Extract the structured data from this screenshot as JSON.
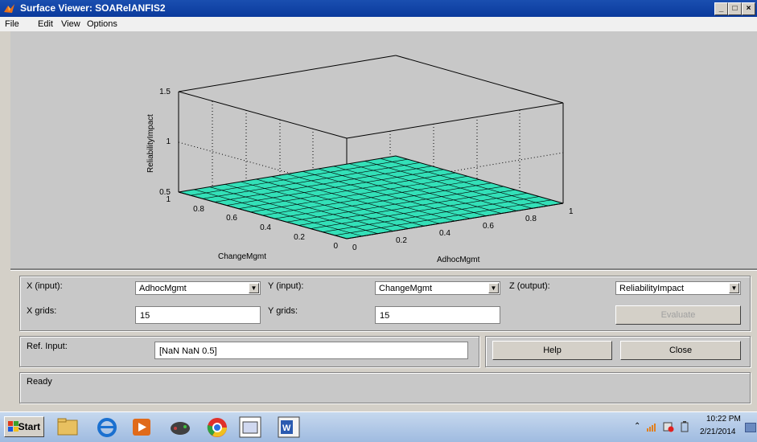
{
  "window": {
    "title": "Surface Viewer: SOARelANFIS2"
  },
  "menu": [
    "File",
    "Edit",
    "View",
    "Options"
  ],
  "plot": {
    "zlabel": "ReliabilityImpact",
    "xlabel": "AdhocMgmt",
    "ylabel": "ChangeMgmt",
    "zticks": [
      "1.5",
      "1",
      "0.5"
    ],
    "xticks": [
      "0",
      "0.2",
      "0.4",
      "0.6",
      "0.8",
      "1"
    ],
    "yticks": [
      "0",
      "0.2",
      "0.4",
      "0.6",
      "0.8",
      "1"
    ],
    "surface_color": "#33e0b8"
  },
  "controls": {
    "x_input_label": "X (input):",
    "x_input_value": "AdhocMgmt",
    "y_input_label": "Y (input):",
    "y_input_value": "ChangeMgmt",
    "z_output_label": "Z (output):",
    "z_output_value": "ReliabilityImpact",
    "x_grids_label": "X grids:",
    "x_grids_value": "15",
    "y_grids_label": "Y grids:",
    "y_grids_value": "15",
    "evaluate_label": "Evaluate",
    "ref_input_label": "Ref. Input:",
    "ref_input_value": "[NaN NaN 0.5]",
    "help_label": "Help",
    "close_label": "Close",
    "status": "Ready"
  },
  "taskbar": {
    "start_label": "Start",
    "time": "10:22 PM",
    "date": "2/21/2014"
  }
}
